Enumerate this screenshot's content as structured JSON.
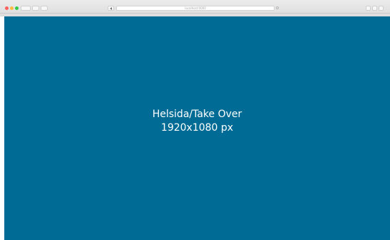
{
  "browser": {
    "address": "localhost:0000"
  },
  "page": {
    "background_color": "#006c96",
    "placeholder_title": "Helsida/Take Over",
    "placeholder_size": "1920x1080 px"
  },
  "colors": {
    "traffic_close": "#fc605c",
    "traffic_minimize": "#fdbc40",
    "traffic_maximize": "#34c84a"
  }
}
